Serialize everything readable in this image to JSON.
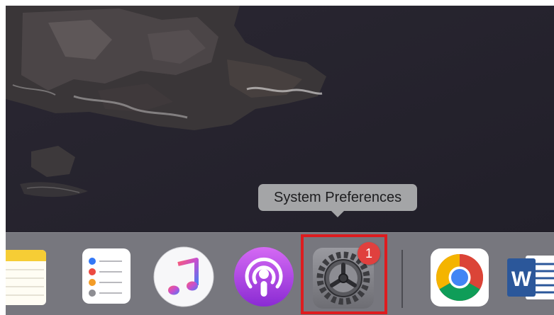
{
  "tooltip": {
    "text": "System Preferences"
  },
  "dock": {
    "apps": [
      {
        "name": "Notes",
        "icon": "notes-icon"
      },
      {
        "name": "Reminders",
        "icon": "reminders-icon"
      },
      {
        "name": "Music",
        "icon": "music-icon"
      },
      {
        "name": "Podcasts",
        "icon": "podcasts-icon"
      },
      {
        "name": "System Preferences",
        "icon": "gear-icon",
        "badge": "1"
      },
      {
        "name": "Google Chrome",
        "icon": "chrome-icon"
      },
      {
        "name": "Microsoft Word",
        "icon": "word-icon",
        "letter": "W"
      }
    ]
  },
  "colors": {
    "highlight_border": "#dd1c1f",
    "badge": "#e0403e",
    "dock": "#77777e",
    "tooltip": "#a4a5a7"
  }
}
